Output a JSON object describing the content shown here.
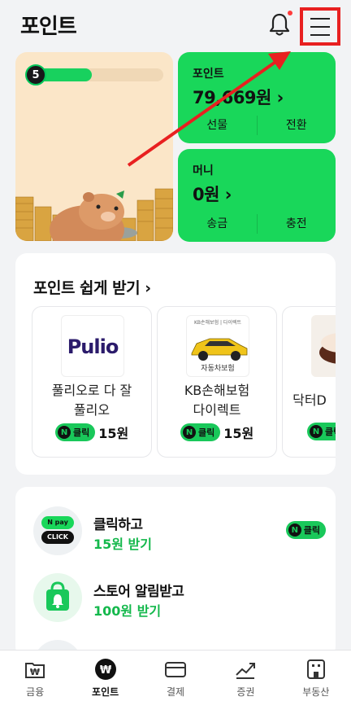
{
  "header": {
    "title": "포인트"
  },
  "level": {
    "number": "5",
    "progress": 0.45
  },
  "point_card": {
    "label": "포인트",
    "value": "79,669원 ›",
    "action_gift": "선물",
    "action_convert": "전환"
  },
  "money_card": {
    "label": "머니",
    "value": "0원 ›",
    "action_send": "송금",
    "action_charge": "충전"
  },
  "offers": {
    "title": "포인트 쉽게 받기 ›",
    "items": [
      {
        "name_line1": "풀리오로 다 잘",
        "name_line2": "풀리오",
        "logo_text": "Pulio",
        "badge": "클릭",
        "amount": "15원"
      },
      {
        "name_line1": "KB손해보험",
        "name_line2": "다이렉트",
        "image_caption": "자동차보험",
        "image_header": "KB손해보험 | 다이렉트",
        "badge": "클릭",
        "amount": "15원"
      },
      {
        "name_line1": "닥터D",
        "name_line2": "",
        "badge": "클릭",
        "amount": ""
      }
    ]
  },
  "tasks": {
    "items": [
      {
        "title": "클릭하고",
        "subtitle": "15원 받기",
        "icon_top": "N pay",
        "icon_bottom": "CLICK",
        "badge": "클릭"
      },
      {
        "title": "스토어 알림받고",
        "subtitle": "100원 받기"
      }
    ]
  },
  "nav": {
    "items": [
      {
        "label": "금융",
        "icon": "wallet-won-icon"
      },
      {
        "label": "포인트",
        "icon": "won-coin-icon"
      },
      {
        "label": "결제",
        "icon": "card-icon"
      },
      {
        "label": "증권",
        "icon": "chart-up-icon"
      },
      {
        "label": "부동산",
        "icon": "building-icon"
      }
    ]
  },
  "colors": {
    "accent_green": "#19d75a",
    "annotation_red": "#e82020"
  }
}
